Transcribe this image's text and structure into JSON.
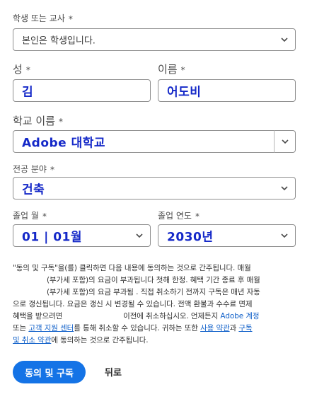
{
  "role": {
    "label": "학생 또는 교사",
    "value": "본인은 학생입니다."
  },
  "last_name": {
    "label": "성",
    "value": "김"
  },
  "first_name": {
    "label": "이름",
    "value": "어도비"
  },
  "school": {
    "label": "학교 이름",
    "value": "Adobe 대학교"
  },
  "major": {
    "label": "전공 분야",
    "value": "건축"
  },
  "grad_month": {
    "label": "졸업 월",
    "value": "01 | 01월"
  },
  "grad_year": {
    "label": "졸업 연도",
    "value": "2030년"
  },
  "required_mark": "*",
  "legal": {
    "line1": "\"동의 및 구독\"을(를) 클릭하면 다음 내용에 동의하는 것으로 간주됩니다. 매월",
    "line2": "(부가세 포함)의 요금이 부과됩니다 첫해 한정. 혜택 기간 종료 후 매월",
    "line3": "(부가세 포함)의 요금 부과됨 . 직접 취소하기 전까지 구독은 매년 자동",
    "line4": "으로 갱신됩니다. 요금은 갱신 시 변경될 수 있습니다. 전액 환불과 수수료 면제",
    "line5a": "혜택을 받으려면",
    "line5b": "이전에 취소하십시오. 언제든지",
    "link_account": "Adobe 계정",
    "line6a": "또는",
    "link_support": "고객 지원 센터",
    "line6b": "를 통해 취소할 수 있습니다. 귀하는 또한",
    "link_terms": "사용 약관",
    "line6c": "과",
    "link_cancel1": "구독",
    "link_cancel2": "및 취소 약관",
    "line7": "에 동의하는 것으로 간주됩니다."
  },
  "buttons": {
    "agree": "동의 및 구독",
    "back": "뒤로"
  },
  "colors": {
    "primary": "#1473e6",
    "link": "#1060c9",
    "handwriting": "#1428c8"
  }
}
